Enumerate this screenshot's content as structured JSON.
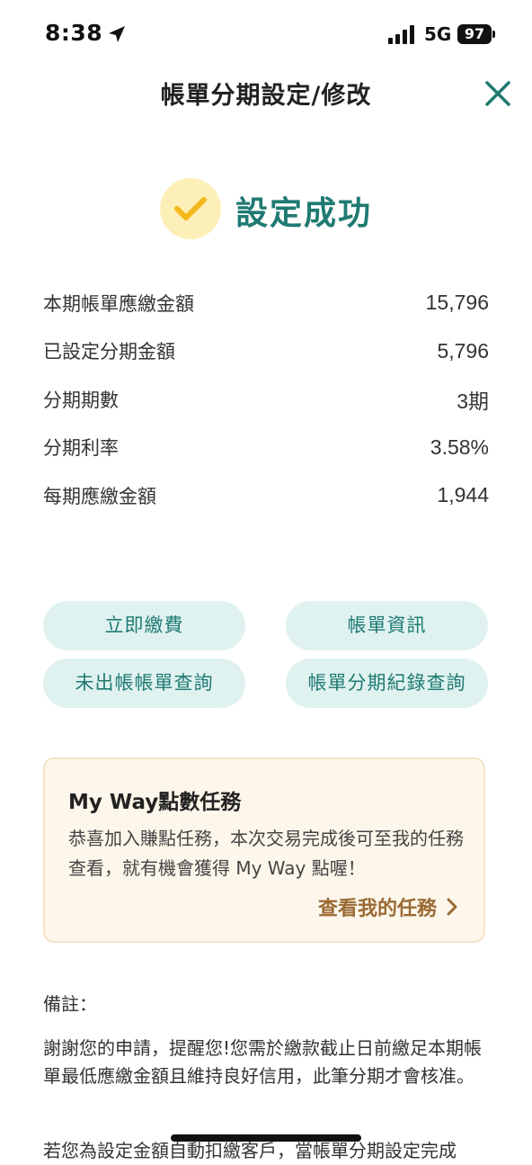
{
  "status_bar": {
    "time": "8:38",
    "network": "5G",
    "battery": "97"
  },
  "header": {
    "title": "帳單分期設定/修改"
  },
  "result": {
    "message": "設定成功"
  },
  "details": [
    {
      "label": "本期帳單應繳金額",
      "value": "15,796"
    },
    {
      "label": "已設定分期金額",
      "value": "5,796"
    },
    {
      "label": "分期期數",
      "value": "3期"
    },
    {
      "label": "分期利率",
      "value": "3.58%"
    },
    {
      "label": "每期應繳金額",
      "value": "1,944"
    }
  ],
  "actions": {
    "pay_now": "立即繳費",
    "bill_info": "帳單資訊",
    "unbilled_query": "未出帳帳單查詢",
    "installment_history": "帳單分期紀錄查詢"
  },
  "mission": {
    "title": "My Way點數任務",
    "description": "恭喜加入賺點任務，本次交易完成後可至我的任務查看，就有機會獲得 My Way 點喔！",
    "link_label": "查看我的任務"
  },
  "notes": {
    "label": "備註：",
    "text": "謝謝您的申請，提醒您!您需於繳款截止日前繳足本期帳單最低應繳金額且維持良好信用，此筆分期才會核准。",
    "text_partial": "若您為設定金額自動扣繳客戶，當帳單分期設定完成"
  },
  "colors": {
    "accent": "#1f7a72",
    "button_bg": "#dff2f0",
    "success_circle": "#fdefb8",
    "check": "#f3b81a",
    "card_bg": "#fdf6ea",
    "card_link": "#9a6a34"
  }
}
